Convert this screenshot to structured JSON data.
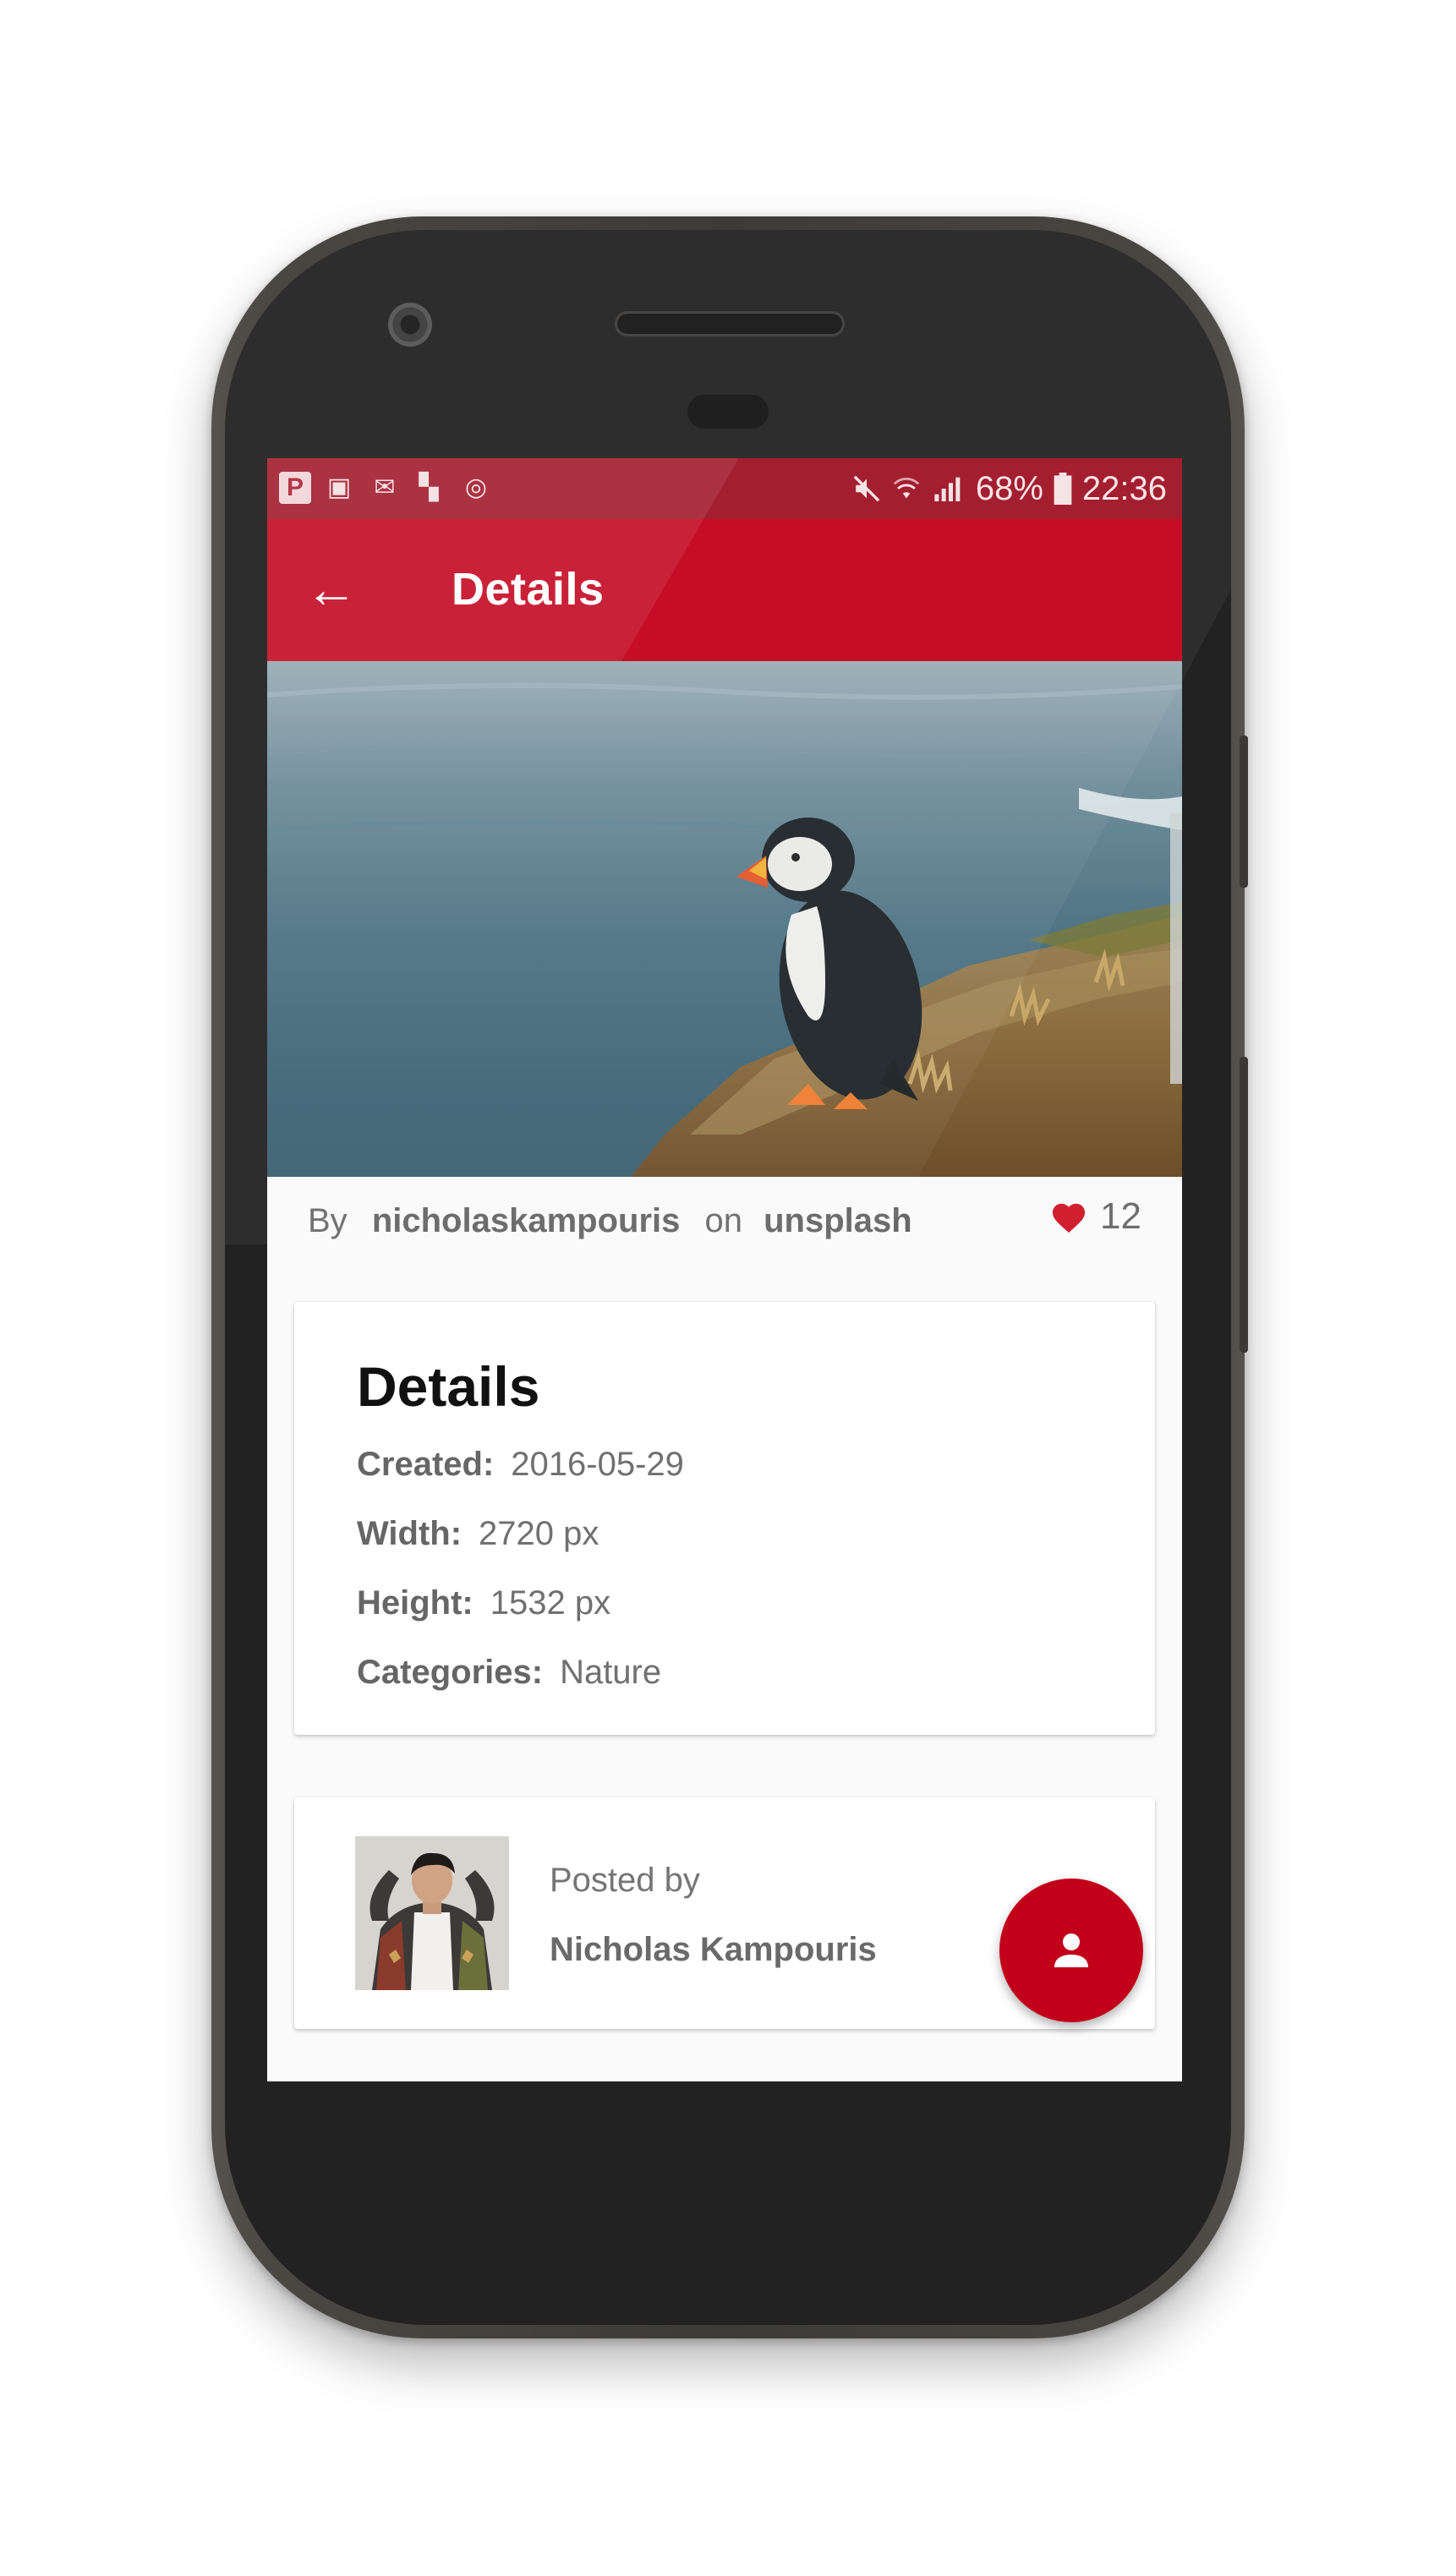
{
  "status_bar": {
    "notification_icons": [
      "P",
      "image-icon",
      "mail-icon",
      "flipboard-icon",
      "sync-icon"
    ],
    "notification_glyphs": [
      "P",
      "▣",
      "✉",
      "▚",
      "◎"
    ],
    "mute_icon": "mute-icon",
    "wifi_icon": "wifi-icon",
    "signal_icon": "signal-icon",
    "battery_percent": "68%",
    "battery_icon": "battery-icon",
    "time": "22:36"
  },
  "app_bar": {
    "back_icon": "arrow-back-icon",
    "back_glyph": "←",
    "title": "Details"
  },
  "byline": {
    "by": "By",
    "author": "nicholaskampouris",
    "on": "on",
    "source": "unsplash",
    "likes": "12"
  },
  "details_card": {
    "heading": "Details",
    "rows": [
      {
        "label": "Created:",
        "value": "2016-05-29"
      },
      {
        "label": "Width:",
        "value": "2720 px"
      },
      {
        "label": "Height:",
        "value": "1532 px"
      },
      {
        "label": "Categories:",
        "value": "Nature"
      }
    ]
  },
  "user_card": {
    "posted_label": "Posted by",
    "name": "Nicholas Kampouris"
  },
  "colors": {
    "primary": "#c2001a",
    "status_bar": "#9f1324",
    "background": "#fafafa",
    "heart": "#d0202f"
  }
}
